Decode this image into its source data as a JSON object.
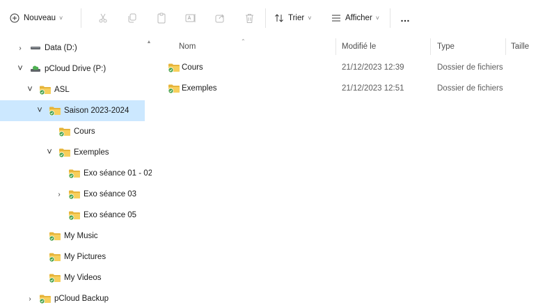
{
  "toolbar": {
    "new_label": "Nouveau",
    "sort_label": "Trier",
    "view_label": "Afficher",
    "more_label": "…"
  },
  "nav": {
    "items": [
      {
        "label": "Data (D:)",
        "expander": "›",
        "icon": "drive-icon"
      },
      {
        "label": "pCloud Drive (P:)",
        "expander": "˅",
        "icon": "cloud-drive-icon"
      },
      {
        "label": "ASL",
        "expander": "˅",
        "icon": "synced-folder-icon"
      },
      {
        "label": "Saison 2023-2024",
        "expander": "˅",
        "icon": "synced-folder-icon",
        "selected": true
      },
      {
        "label": "Cours",
        "expander": "",
        "icon": "synced-folder-icon"
      },
      {
        "label": "Exemples",
        "expander": "˅",
        "icon": "synced-folder-icon"
      },
      {
        "label": "Exo séance 01 - 02",
        "expander": "",
        "icon": "synced-folder-icon"
      },
      {
        "label": "Exo séance 03",
        "expander": "›",
        "icon": "synced-folder-icon"
      },
      {
        "label": "Exo séance 05",
        "expander": "",
        "icon": "synced-folder-icon"
      },
      {
        "label": "My Music",
        "expander": "",
        "icon": "synced-folder-icon"
      },
      {
        "label": "My Pictures",
        "expander": "",
        "icon": "synced-folder-icon"
      },
      {
        "label": "My Videos",
        "expander": "",
        "icon": "synced-folder-icon"
      },
      {
        "label": "pCloud Backup",
        "expander": "›",
        "icon": "synced-folder-icon"
      }
    ]
  },
  "columns": {
    "name": "Nom",
    "modified": "Modifié le",
    "type": "Type",
    "size": "Taille"
  },
  "files": [
    {
      "name": "Cours",
      "modified": "21/12/2023 12:39",
      "type": "Dossier de fichiers",
      "size": ""
    },
    {
      "name": "Exemples",
      "modified": "21/12/2023 12:51",
      "type": "Dossier de fichiers",
      "size": ""
    }
  ],
  "colors": {
    "selection": "#cce8ff",
    "folder": "#f2c94c",
    "sync_check": "#4caf50"
  }
}
